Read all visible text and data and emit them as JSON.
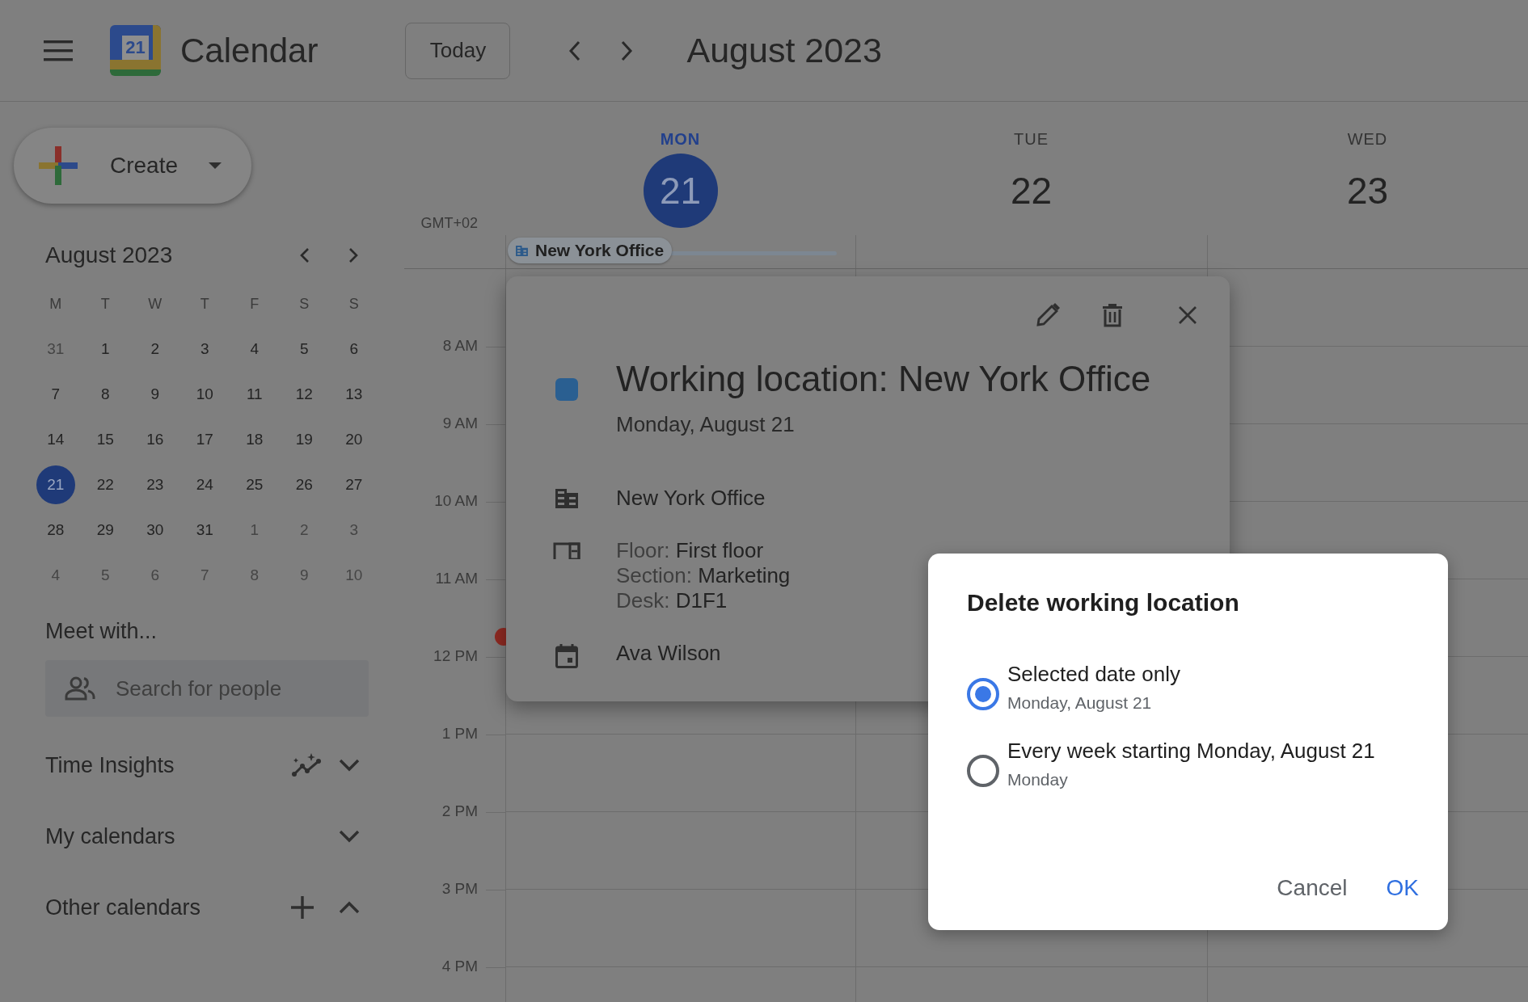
{
  "app": {
    "title": "Calendar",
    "logo_day": "21"
  },
  "toolbar": {
    "today": "Today",
    "period": "August 2023"
  },
  "create": {
    "label": "Create"
  },
  "mini_calendar": {
    "title": "August 2023",
    "weekdays": [
      "M",
      "T",
      "W",
      "T",
      "F",
      "S",
      "S"
    ],
    "days": [
      {
        "label": "31",
        "in_month": false,
        "selected": false
      },
      {
        "label": "1",
        "in_month": true,
        "selected": false
      },
      {
        "label": "2",
        "in_month": true,
        "selected": false
      },
      {
        "label": "3",
        "in_month": true,
        "selected": false
      },
      {
        "label": "4",
        "in_month": true,
        "selected": false
      },
      {
        "label": "5",
        "in_month": true,
        "selected": false
      },
      {
        "label": "6",
        "in_month": true,
        "selected": false
      },
      {
        "label": "7",
        "in_month": true,
        "selected": false
      },
      {
        "label": "8",
        "in_month": true,
        "selected": false
      },
      {
        "label": "9",
        "in_month": true,
        "selected": false
      },
      {
        "label": "10",
        "in_month": true,
        "selected": false
      },
      {
        "label": "11",
        "in_month": true,
        "selected": false
      },
      {
        "label": "12",
        "in_month": true,
        "selected": false
      },
      {
        "label": "13",
        "in_month": true,
        "selected": false
      },
      {
        "label": "14",
        "in_month": true,
        "selected": false
      },
      {
        "label": "15",
        "in_month": true,
        "selected": false
      },
      {
        "label": "16",
        "in_month": true,
        "selected": false
      },
      {
        "label": "17",
        "in_month": true,
        "selected": false
      },
      {
        "label": "18",
        "in_month": true,
        "selected": false
      },
      {
        "label": "19",
        "in_month": true,
        "selected": false
      },
      {
        "label": "20",
        "in_month": true,
        "selected": false
      },
      {
        "label": "21",
        "in_month": true,
        "selected": true
      },
      {
        "label": "22",
        "in_month": true,
        "selected": false
      },
      {
        "label": "23",
        "in_month": true,
        "selected": false
      },
      {
        "label": "24",
        "in_month": true,
        "selected": false
      },
      {
        "label": "25",
        "in_month": true,
        "selected": false
      },
      {
        "label": "26",
        "in_month": true,
        "selected": false
      },
      {
        "label": "27",
        "in_month": true,
        "selected": false
      },
      {
        "label": "28",
        "in_month": true,
        "selected": false
      },
      {
        "label": "29",
        "in_month": true,
        "selected": false
      },
      {
        "label": "30",
        "in_month": true,
        "selected": false
      },
      {
        "label": "31",
        "in_month": true,
        "selected": false
      },
      {
        "label": "1",
        "in_month": false,
        "selected": false
      },
      {
        "label": "2",
        "in_month": false,
        "selected": false
      },
      {
        "label": "3",
        "in_month": false,
        "selected": false
      },
      {
        "label": "4",
        "in_month": false,
        "selected": false
      },
      {
        "label": "5",
        "in_month": false,
        "selected": false
      },
      {
        "label": "6",
        "in_month": false,
        "selected": false
      },
      {
        "label": "7",
        "in_month": false,
        "selected": false
      },
      {
        "label": "8",
        "in_month": false,
        "selected": false
      },
      {
        "label": "9",
        "in_month": false,
        "selected": false
      },
      {
        "label": "10",
        "in_month": false,
        "selected": false
      }
    ]
  },
  "meet_with": {
    "title": "Meet with...",
    "placeholder": "Search for people"
  },
  "sections": [
    {
      "title": "Time Insights",
      "kind": "insights",
      "expanded": false
    },
    {
      "title": "My calendars",
      "kind": "plain",
      "expanded": false
    },
    {
      "title": "Other calendars",
      "kind": "add",
      "expanded": true
    }
  ],
  "week": {
    "timezone": "GMT+02",
    "days": [
      {
        "weekday": "MON",
        "date": "21",
        "selected": true,
        "all_day": [
          {
            "label": "New York Office"
          }
        ]
      },
      {
        "weekday": "TUE",
        "date": "22",
        "selected": false
      },
      {
        "weekday": "WED",
        "date": "23",
        "selected": false
      }
    ],
    "hours": [
      "8 AM",
      "9 AM",
      "10 AM",
      "11 AM",
      "12 PM",
      "1 PM",
      "2 PM",
      "3 PM",
      "4 PM"
    ]
  },
  "event_popup": {
    "title": "Working location: New York Office",
    "date": "Monday, August 21",
    "location": "New York Office",
    "details": [
      {
        "label": "Floor:",
        "value": "First floor"
      },
      {
        "label": "Section:",
        "value": "Marketing"
      },
      {
        "label": "Desk:",
        "value": "D1F1"
      }
    ],
    "calendar": "Ava Wilson"
  },
  "dialog": {
    "title": "Delete working location",
    "options": [
      {
        "label": "Selected date only",
        "sublabel": "Monday, August 21",
        "selected": true
      },
      {
        "label": "Every week starting Monday, August 21",
        "sublabel": "Monday",
        "selected": false
      }
    ],
    "buttons": [
      {
        "label": "Cancel",
        "kind": "secondary"
      },
      {
        "label": "OK",
        "kind": "primary"
      }
    ]
  }
}
